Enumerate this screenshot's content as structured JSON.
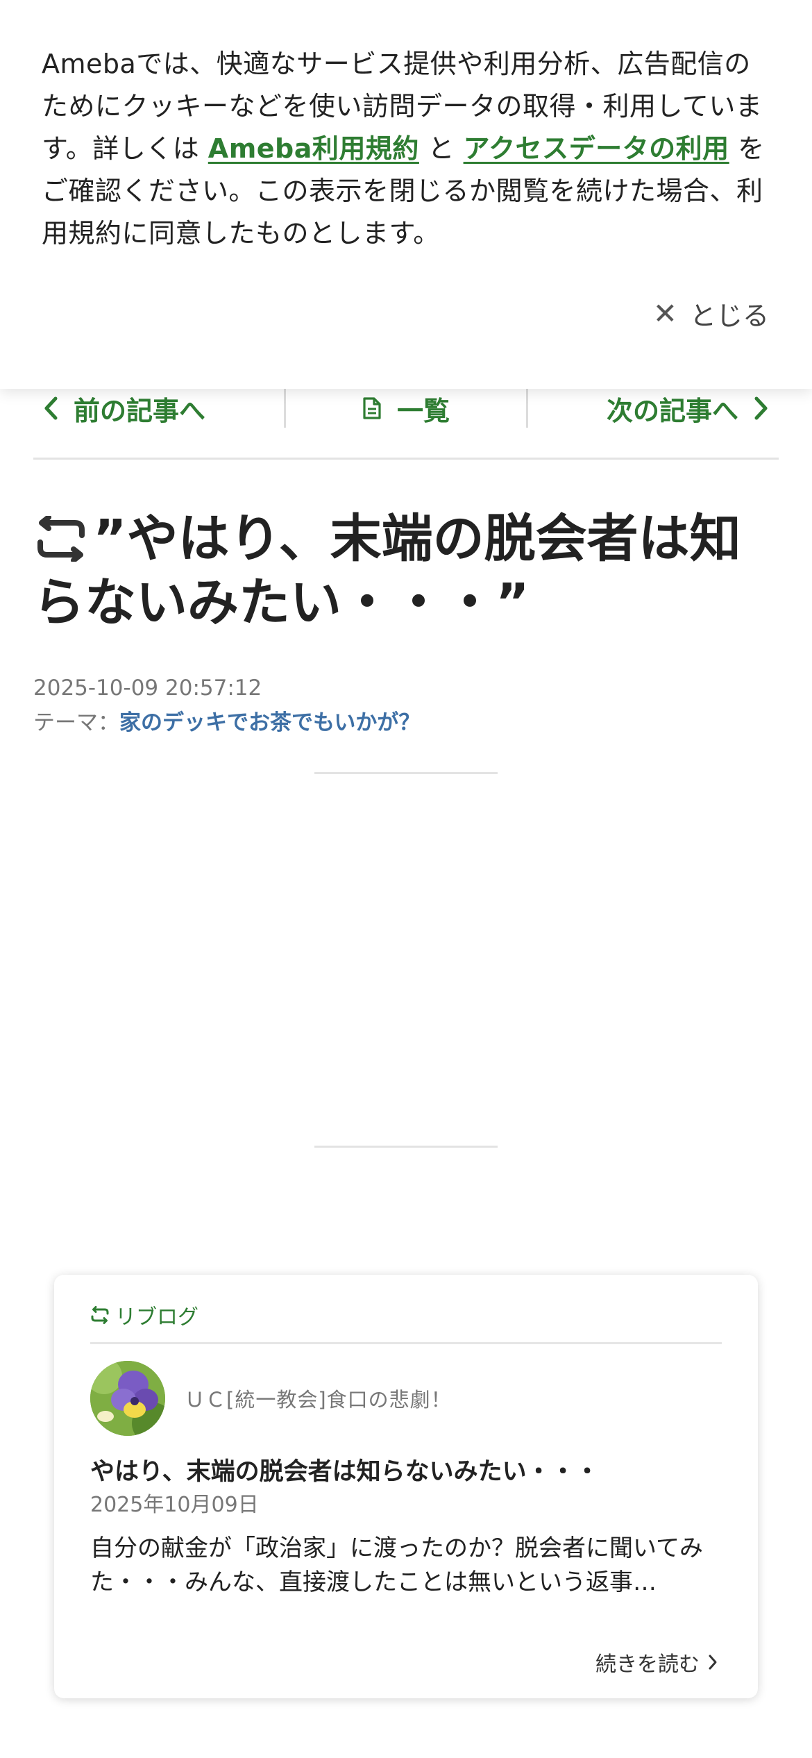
{
  "cookie_banner": {
    "text_part1": "Amebaでは、快適なサービス提供や利用分析、広告配信のためにクッキーなどを使い訪問データの取得・利用しています。詳しくは ",
    "link1": "Ameba利用規約",
    "text_part2": " と ",
    "link2": "アクセスデータの利用",
    "text_part3": " をご確認ください。この表示を閉じるか閲覧を続けた場合、利用規約に同意したものとします。",
    "close_label": "とじる",
    "close_icon": "close-icon"
  },
  "article_nav": {
    "prev_label": "前の記事へ",
    "list_label": "一覧",
    "next_label": "次の記事へ"
  },
  "article": {
    "title": "”やはり、末端の脱会者は知らないみたい・・・”",
    "datetime": "2025-10-09 20:57:12",
    "theme_prefix": "テーマ：",
    "theme": "家のデッキでお茶でもいかが？"
  },
  "reblog_card": {
    "header_label": "リブログ",
    "blog_name": "ＵＣ[統一教会]食口の悲劇！",
    "post_title": "やはり、末端の脱会者は知らないみたい・・・",
    "post_date": "2025年10月09日",
    "excerpt": "自分の献金が「政治家」に渡ったのか？脱会者に聞いてみた・・・みんな、直接渡したことは無いという返事…",
    "read_more_label": "続きを読む"
  },
  "colors": {
    "accent_green": "#2e7d32",
    "theme_link_blue": "#3d6fa5",
    "text_primary": "#222222",
    "text_muted": "#777777"
  }
}
